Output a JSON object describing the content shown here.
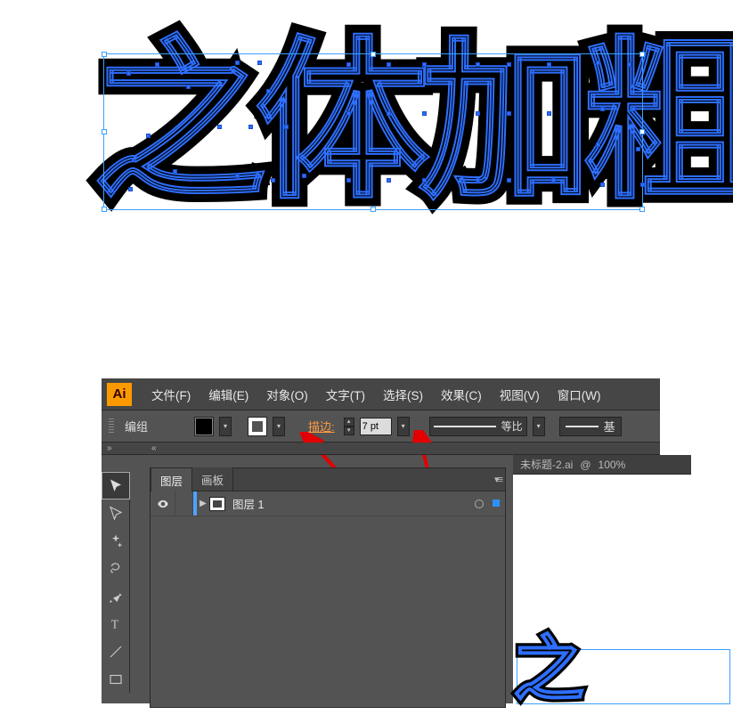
{
  "canvas": {
    "big_text": "之体加粗"
  },
  "menubar": {
    "logo": "Ai",
    "items": [
      "文件(F)",
      "编辑(E)",
      "对象(O)",
      "文字(T)",
      "选择(S)",
      "效果(C)",
      "视图(V)",
      "窗口(W)"
    ]
  },
  "controlbar": {
    "mode": "编组",
    "stroke_label": "描边:",
    "stroke_value": "7 pt",
    "profile_label": "等比",
    "basic_label": "基"
  },
  "document": {
    "tab": "未标题-2.ai",
    "zoom": "100%"
  },
  "layers_panel": {
    "tab_layers": "图层",
    "tab_artboards": "画板",
    "row_name": "图层 1"
  },
  "workspace": {
    "glyph_preview": "之"
  }
}
